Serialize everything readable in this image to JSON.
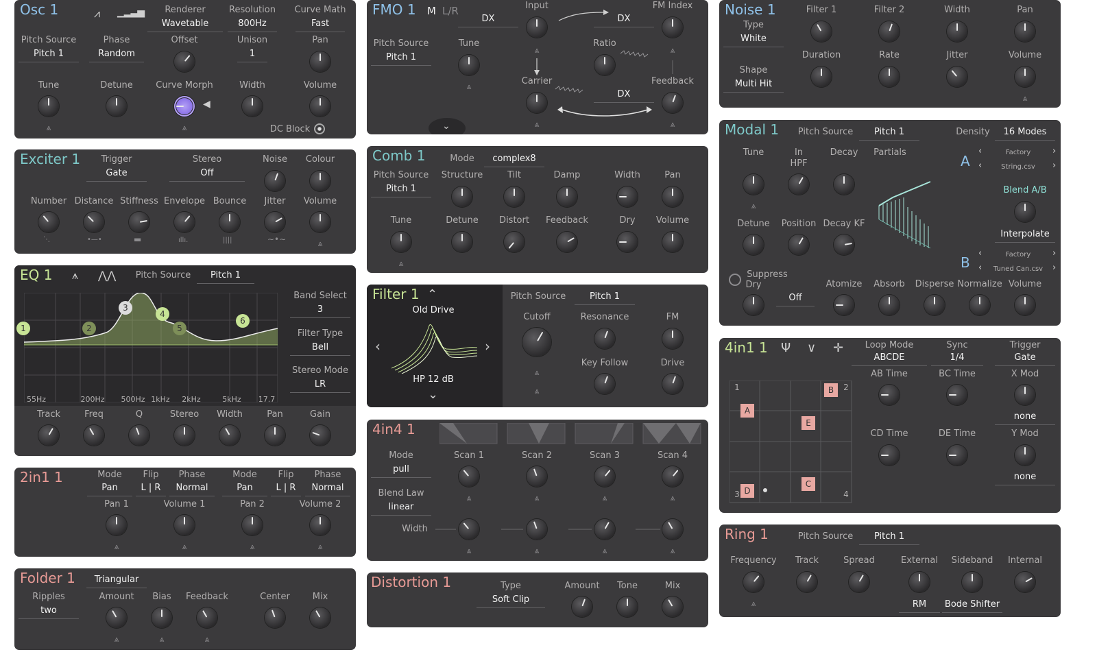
{
  "colors": {
    "osc_title": "#8fc1e8",
    "exciter_title": "#7ec9c9",
    "eq_title": "#c7e495",
    "twoinone_title": "#e79a95",
    "folder_title": "#e79a95",
    "fmo_title": "#8fc1e8",
    "comb_title": "#7ec9c9",
    "filter_title": "#c7e495",
    "fourinfour_title": "#e79a95",
    "distortion_title": "#e79a95",
    "noise_title": "#8fc1e8",
    "modal_title": "#7ec9c9",
    "fourinone_title": "#c7e495",
    "ring_title": "#e79a95",
    "eq_curve": "#9fbe6b"
  },
  "icons": {
    "mod_arrow": "⩓",
    "double_arrow": "⇈"
  },
  "osc": {
    "title": "Osc 1",
    "renderer_label": "Renderer",
    "renderer_value": "Wavetable",
    "resolution_label": "Resolution",
    "resolution_value": "800Hz",
    "curve_math_label": "Curve Math",
    "curve_math_value": "Fast",
    "pitch_source_label": "Pitch Source",
    "pitch_source_value": "Pitch 1",
    "phase_label": "Phase",
    "phase_value": "Random",
    "offset_label": "Offset",
    "unison_label": "Unison",
    "unison_value": "1",
    "pan_label": "Pan",
    "tune_label": "Tune",
    "detune_label": "Detune",
    "curve_morph_label": "Curve Morph",
    "width_label": "Width",
    "volume_label": "Volume",
    "dc_block_label": "DC Block"
  },
  "exciter": {
    "title": "Exciter 1",
    "trigger_label": "Trigger",
    "trigger_value": "Gate",
    "stereo_label": "Stereo",
    "stereo_value": "Off",
    "noise_label": "Noise",
    "colour_label": "Colour",
    "number_label": "Number",
    "distance_label": "Distance",
    "stiffness_label": "Stiffness",
    "envelope_label": "Envelope",
    "bounce_label": "Bounce",
    "jitter_label": "Jitter",
    "volume_label": "Volume"
  },
  "eq": {
    "title": "EQ 1",
    "pitch_source_label": "Pitch Source",
    "pitch_source_value": "Pitch 1",
    "band_select_label": "Band Select",
    "band_select_value": "3",
    "filter_type_label": "Filter Type",
    "filter_type_value": "Bell",
    "stereo_mode_label": "Stereo Mode",
    "stereo_mode_value": "LR",
    "freq_ticks": [
      "55Hz",
      "200Hz",
      "500Hz",
      "1kHz",
      "2kHz",
      "5kHz",
      "17.7"
    ],
    "bands": [
      "1",
      "2",
      "3",
      "4",
      "5",
      "6"
    ],
    "knobs": [
      "Track",
      "Freq",
      "Q",
      "Stereo",
      "Width",
      "Pan",
      "Gain"
    ]
  },
  "twoinone": {
    "title": "2in1 1",
    "mode1_label": "Mode",
    "mode1_value": "Pan",
    "flip1_label": "Flip",
    "flip1_value": "L | R",
    "phase1_label": "Phase",
    "phase1_value": "Normal",
    "mode2_label": "Mode",
    "mode2_value": "Pan",
    "flip2_label": "Flip",
    "flip2_value": "L | R",
    "phase2_label": "Phase",
    "phase2_value": "Normal",
    "pan1_label": "Pan 1",
    "volume1_label": "Volume 1",
    "pan2_label": "Pan 2",
    "volume2_label": "Volume 2"
  },
  "folder": {
    "title": "Folder 1",
    "type_value": "Triangular",
    "ripples_label": "Ripples",
    "ripples_value": "two",
    "amount_label": "Amount",
    "bias_label": "Bias",
    "feedback_label": "Feedback",
    "center_label": "Center",
    "mix_label": "Mix"
  },
  "fmo": {
    "title": "FMO 1",
    "mode_m": "M",
    "mode_lr": "L/R",
    "dx1": "DX",
    "input_label": "Input",
    "dx2": "DX",
    "fm_index_label": "FM Index",
    "pitch_source_label": "Pitch Source",
    "pitch_source_value": "Pitch 1",
    "tune_label": "Tune",
    "ratio_label": "Ratio",
    "carrier_label": "Carrier",
    "feedback_label": "Feedback",
    "dx3": "DX"
  },
  "comb": {
    "title": "Comb 1",
    "mode_label": "Mode",
    "mode_value": "complex8",
    "pitch_source_label": "Pitch Source",
    "pitch_source_value": "Pitch 1",
    "structure_label": "Structure",
    "tilt_label": "Tilt",
    "damp_label": "Damp",
    "width_label": "Width",
    "pan_label": "Pan",
    "tune_label": "Tune",
    "detune_label": "Detune",
    "distort_label": "Distort",
    "feedback_label": "Feedback",
    "dry_label": "Dry",
    "volume_label": "Volume"
  },
  "filter": {
    "title": "Filter 1",
    "model_name": "Old Drive",
    "model_type": "HP 12 dB",
    "pitch_source_label": "Pitch Source",
    "pitch_source_value": "Pitch 1",
    "cutoff_label": "Cutoff",
    "resonance_label": "Resonance",
    "fm_label": "FM",
    "key_follow_label": "Key Follow",
    "drive_label": "Drive"
  },
  "fourinfour": {
    "title": "4in4 1",
    "mode_label": "Mode",
    "mode_value": "pull",
    "blend_law_label": "Blend Law",
    "blend_law_value": "linear",
    "width_label": "Width",
    "scans": [
      "Scan 1",
      "Scan 2",
      "Scan 3",
      "Scan 4"
    ]
  },
  "distortion": {
    "title": "Distortion 1",
    "type_label": "Type",
    "type_value": "Soft Clip",
    "amount_label": "Amount",
    "tone_label": "Tone",
    "mix_label": "Mix"
  },
  "noise": {
    "title": "Noise 1",
    "type_label": "Type",
    "type_value": "White",
    "shape_label": "Shape",
    "shape_value": "Multi Hit",
    "filter1_label": "Filter 1",
    "filter2_label": "Filter 2",
    "width_label": "Width",
    "pan_label": "Pan",
    "duration_label": "Duration",
    "rate_label": "Rate",
    "jitter_label": "Jitter",
    "volume_label": "Volume"
  },
  "modal": {
    "title": "Modal 1",
    "pitch_source_label": "Pitch Source",
    "pitch_source_value": "Pitch 1",
    "density_label": "Density",
    "density_value": "16 Modes",
    "tune_label": "Tune",
    "in_hpf_label": "In\nHPF",
    "decay_label": "Decay",
    "partials_label": "Partials",
    "detune_label": "Detune",
    "position_label": "Position",
    "decay_kf_label": "Decay KF",
    "a_label": "A",
    "a_bank": "Factory",
    "a_file": "String.csv",
    "b_label": "B",
    "b_bank": "Factory",
    "b_file": "Tuned Can.csv",
    "blend_label": "Blend A/B",
    "interpolate_label": "Interpolate",
    "suppress_label": "Suppress",
    "dry_label": "Dry",
    "off_value": "Off",
    "atomize_label": "Atomize",
    "absorb_label": "Absorb",
    "disperse_label": "Disperse",
    "normalize_label": "Normalize",
    "volume_label": "Volume"
  },
  "fourinone": {
    "title": "4in1 1",
    "loop_mode_label": "Loop Mode",
    "loop_mode_value": "ABCDE",
    "sync_label": "Sync",
    "sync_value": "1/4",
    "trigger_label": "Trigger",
    "trigger_value": "Gate",
    "ab_time_label": "AB Time",
    "bc_time_label": "BC Time",
    "x_mod_label": "X Mod",
    "x_mod_value": "none",
    "cd_time_label": "CD Time",
    "de_time_label": "DE Time",
    "y_mod_label": "Y Mod",
    "y_mod_value": "none",
    "corner1": "1",
    "corner2": "2",
    "corner3": "3",
    "corner4": "4",
    "point_a": "A",
    "point_b": "B",
    "point_c": "C",
    "point_d": "D",
    "point_e": "E"
  },
  "ring": {
    "title": "Ring 1",
    "pitch_source_label": "Pitch Source",
    "pitch_source_value": "Pitch 1",
    "frequency_label": "Frequency",
    "track_label": "Track",
    "spread_label": "Spread",
    "external_label": "External",
    "sideband_label": "Sideband",
    "internal_label": "Internal",
    "external_value": "RM",
    "sideband_value": "Bode Shifter"
  }
}
